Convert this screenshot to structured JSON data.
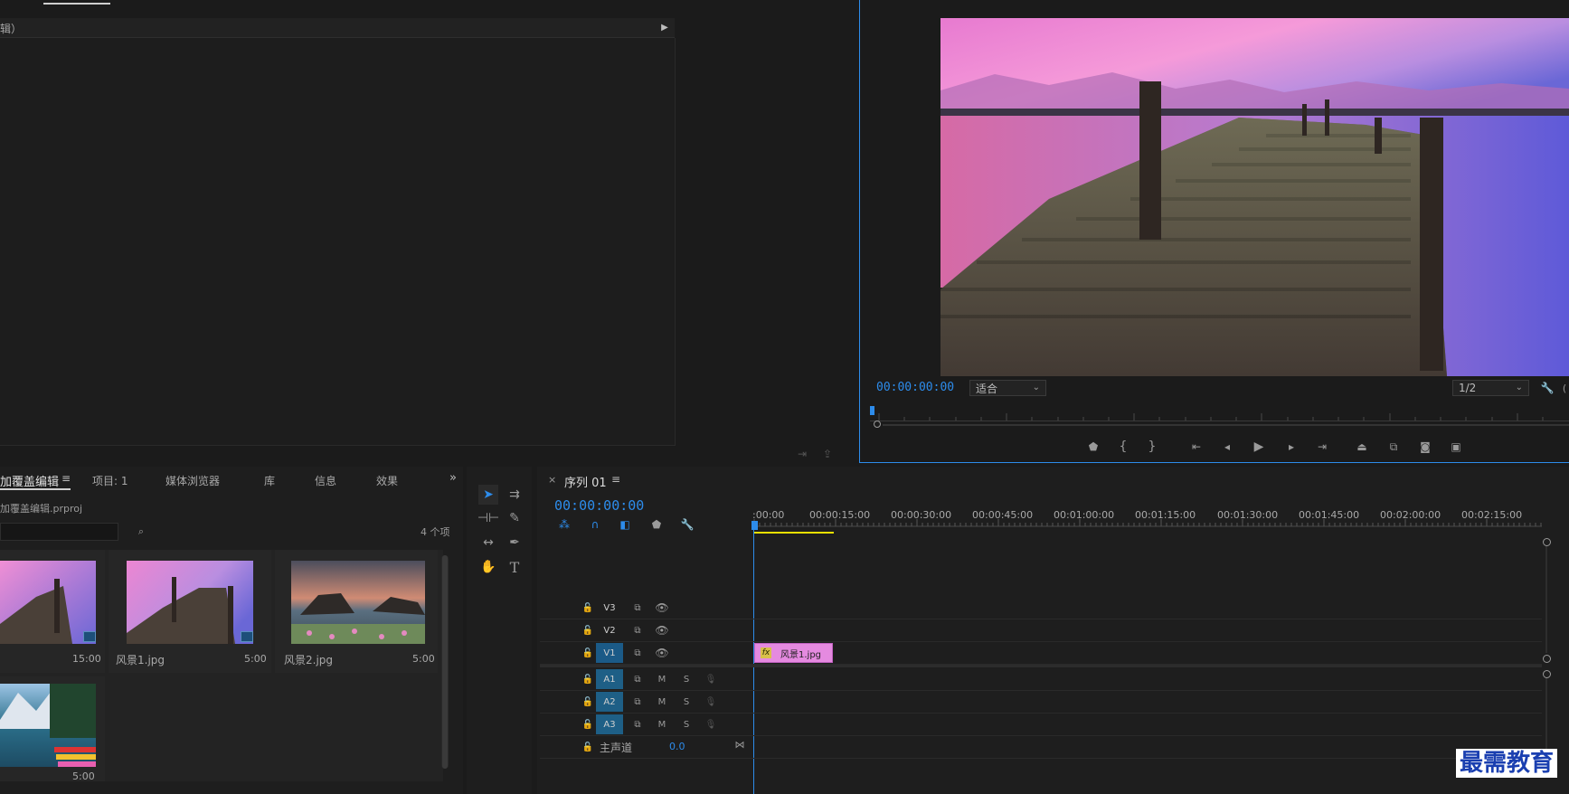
{
  "source_panel": {
    "tab_label": "",
    "header_text": "辑）"
  },
  "program_monitor": {
    "timecode": "00:00:00:00",
    "zoom_value": "适合",
    "resolution_value": "1/2",
    "controls": [
      "marker-icon",
      "mark-in-icon",
      "mark-out-icon",
      "go-to-in-icon",
      "step-back-icon",
      "play-icon",
      "step-forward-icon",
      "go-to-out-icon",
      "lift-icon",
      "extract-icon",
      "export-frame-icon",
      "compare-icon"
    ]
  },
  "project_panel": {
    "tabs": [
      {
        "label": "加覆盖编辑",
        "active": true
      },
      {
        "label": "项目: 1"
      },
      {
        "label": "媒体浏览器"
      },
      {
        "label": "库"
      },
      {
        "label": "信息"
      },
      {
        "label": "效果"
      }
    ],
    "project_file": "加覆盖编辑.prproj",
    "search_placeholder": "",
    "item_count": "4 个项",
    "items": [
      {
        "name": "",
        "duration": "15:00"
      },
      {
        "name": "风景1.jpg",
        "duration": "5:00"
      },
      {
        "name": "风景2.jpg",
        "duration": "5:00"
      },
      {
        "name": "",
        "duration": "5:00"
      }
    ]
  },
  "timeline": {
    "close": "×",
    "sequence_name": "序列 01",
    "timecode": "00:00:00:00",
    "ruler": [
      ":00:00",
      "00:00:15:00",
      "00:00:30:00",
      "00:00:45:00",
      "00:01:00:00",
      "00:01:15:00",
      "00:01:30:00",
      "00:01:45:00",
      "00:02:00:00",
      "00:02:15:00"
    ],
    "video_tracks": [
      {
        "id": "V3",
        "active": false
      },
      {
        "id": "V2",
        "active": false
      },
      {
        "id": "V1",
        "active": true
      }
    ],
    "audio_tracks": [
      {
        "id": "A1",
        "m": "M",
        "s": "S"
      },
      {
        "id": "A2",
        "m": "M",
        "s": "S"
      },
      {
        "id": "A3",
        "m": "M",
        "s": "S"
      }
    ],
    "master": {
      "label": "主声道",
      "value": "0.0"
    },
    "clip": {
      "fx": "fx",
      "name": "风景1.jpg",
      "color": "#e58ae0"
    }
  },
  "watermark": "最需教育",
  "colors": {
    "accent_blue": "#2d8ceb",
    "work_area": "#e8e000",
    "track_active": "#1b5a87"
  }
}
